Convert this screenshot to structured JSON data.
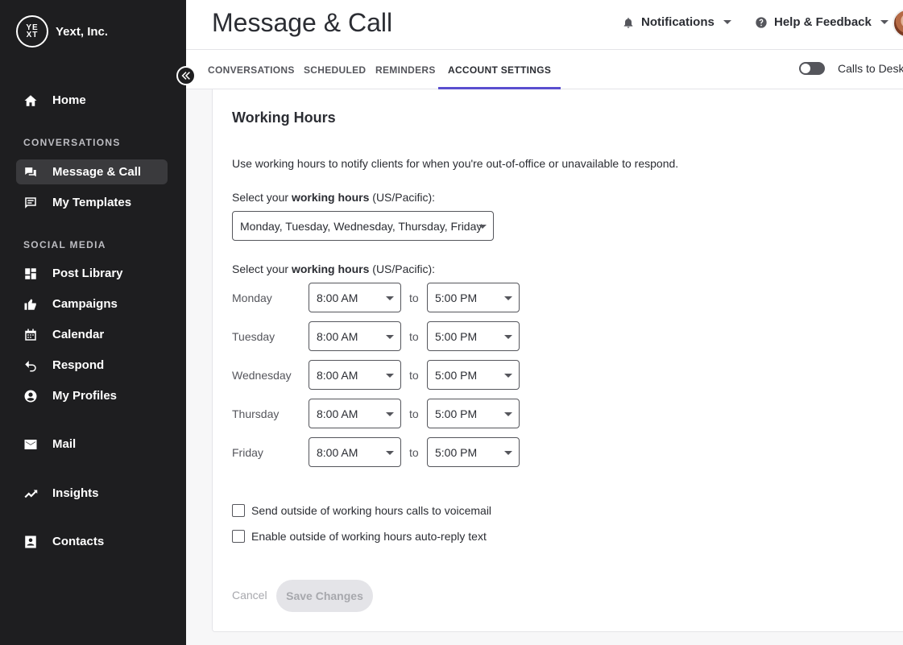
{
  "brand": {
    "logo_text": "YE\nXT",
    "name": "Yext, Inc."
  },
  "sidebar": {
    "items": [
      {
        "label": "Home",
        "icon": "home-icon"
      },
      {
        "label": "Message & Call",
        "icon": "chat-icon",
        "active": true
      },
      {
        "label": "My Templates",
        "icon": "template-icon"
      },
      {
        "label": "Post Library",
        "icon": "dashboard-icon"
      },
      {
        "label": "Campaigns",
        "icon": "thumbs-up-icon"
      },
      {
        "label": "Calendar",
        "icon": "calendar-icon"
      },
      {
        "label": "Respond",
        "icon": "reply-icon"
      },
      {
        "label": "My Profiles",
        "icon": "profile-icon"
      },
      {
        "label": "Mail",
        "icon": "mail-icon"
      },
      {
        "label": "Insights",
        "icon": "trending-icon"
      },
      {
        "label": "Contacts",
        "icon": "contact-icon"
      }
    ],
    "sections": {
      "conversations": "CONVERSATIONS",
      "social_media": "SOCIAL MEDIA"
    }
  },
  "header": {
    "title": "Message & Call",
    "notifications": "Notifications",
    "help": "Help & Feedback"
  },
  "tabs": [
    {
      "label": "CONVERSATIONS"
    },
    {
      "label": "SCHEDULED"
    },
    {
      "label": "REMINDERS"
    },
    {
      "label": "ACCOUNT SETTINGS",
      "active": true
    }
  ],
  "toggle": {
    "label": "Calls to Desk",
    "on": false
  },
  "working_hours": {
    "title": "Working Hours",
    "description": "Use working hours to notify clients for when you're out-of-office or unavailable to respond.",
    "label_prefix": "Select your ",
    "label_bold": "working hours",
    "label_suffix": " (US/Pacific):",
    "days_selected": "Monday, Tuesday, Wednesday, Thursday, Friday",
    "to_label": "to",
    "schedule": [
      {
        "day": "Monday",
        "start": "8:00 AM",
        "end": "5:00 PM"
      },
      {
        "day": "Tuesday",
        "start": "8:00 AM",
        "end": "5:00 PM"
      },
      {
        "day": "Wednesday",
        "start": "8:00 AM",
        "end": "5:00 PM"
      },
      {
        "day": "Thursday",
        "start": "8:00 AM",
        "end": "5:00 PM"
      },
      {
        "day": "Friday",
        "start": "8:00 AM",
        "end": "5:00 PM"
      }
    ],
    "voicemail_option": "Send outside of working hours calls to voicemail",
    "autoreply_option": "Enable outside of working hours auto-reply text",
    "cancel": "Cancel",
    "save": "Save Changes"
  }
}
